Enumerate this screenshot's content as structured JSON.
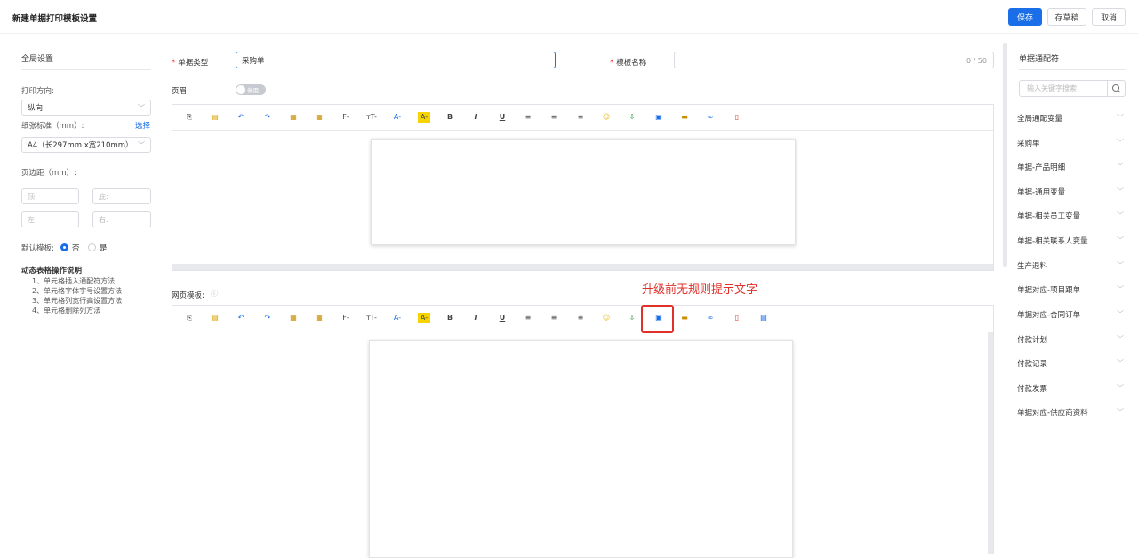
{
  "header": {
    "title": "新建单据打印模板设置",
    "save": "保存",
    "draft": "存草稿",
    "cancel": "取消"
  },
  "left": {
    "section_title": "全局设置",
    "orientation_label": "打印方向:",
    "orientation_value": "纵向",
    "paper_label": "纸张标准（mm）:",
    "paper_link": "选择",
    "paper_value": "A4（长297mm x宽210mm）",
    "margin_label": "页边距（mm）:",
    "margin_top": "顶:",
    "margin_bottom": "底:",
    "margin_left": "左:",
    "margin_right": "右:",
    "default_label": "默认模板:",
    "default_no": "否",
    "default_yes": "是",
    "help_title": "动态表格操作说明",
    "help_items": [
      "1、单元格插入通配符方法",
      "2、单元格字体字号设置方法",
      "3、单元格列宽行高设置方法",
      "4、单元格删除列方法"
    ]
  },
  "center": {
    "doc_type_label": "单据类型",
    "doc_type_value": "采购单",
    "template_name_label": "模板名称",
    "template_name_counter": "0 / 50",
    "header_label": "页眉",
    "toggle_text": "停用",
    "web_template_label": "网页模板:",
    "info_icon": "info-circle-icon",
    "annotation": "升级前无规则提示文字"
  },
  "toolbar_icons": [
    "paste-icon",
    "doc-icon",
    "undo-icon",
    "redo-icon",
    "copy-format-icon",
    "table-icon",
    "font-icon",
    "font-size-icon",
    "font-color-icon",
    "highlight-icon",
    "bold-icon",
    "italic-icon",
    "underline-icon",
    "align-left-icon",
    "align-center-icon",
    "align-right-icon",
    "emoji-icon",
    "insert-icon",
    "image-icon",
    "picture-icon",
    "link-icon",
    "field-icon",
    "grid-icon"
  ],
  "toolbar_glyphs": {
    "bold": "B",
    "italic": "I",
    "underline": "U",
    "font": "F-",
    "font_size": "тT-",
    "font_color": "A-",
    "highlight": "A-"
  },
  "right": {
    "title": "单据通配符",
    "search_placeholder": "输入关键字搜索",
    "items": [
      "全局通配变量",
      "采购单",
      "单据-产品明细",
      "单据-通用变量",
      "单据-相关员工变量",
      "单据-相关联系人变量",
      "生产退料",
      "单据对应-项目跟单",
      "单据对应-合同订单",
      "付款计划",
      "付款记录",
      "付款发票",
      "单据对应-供应商资料"
    ]
  },
  "colors": {
    "primary": "#1a6fe8",
    "annotation": "#e0302a"
  }
}
